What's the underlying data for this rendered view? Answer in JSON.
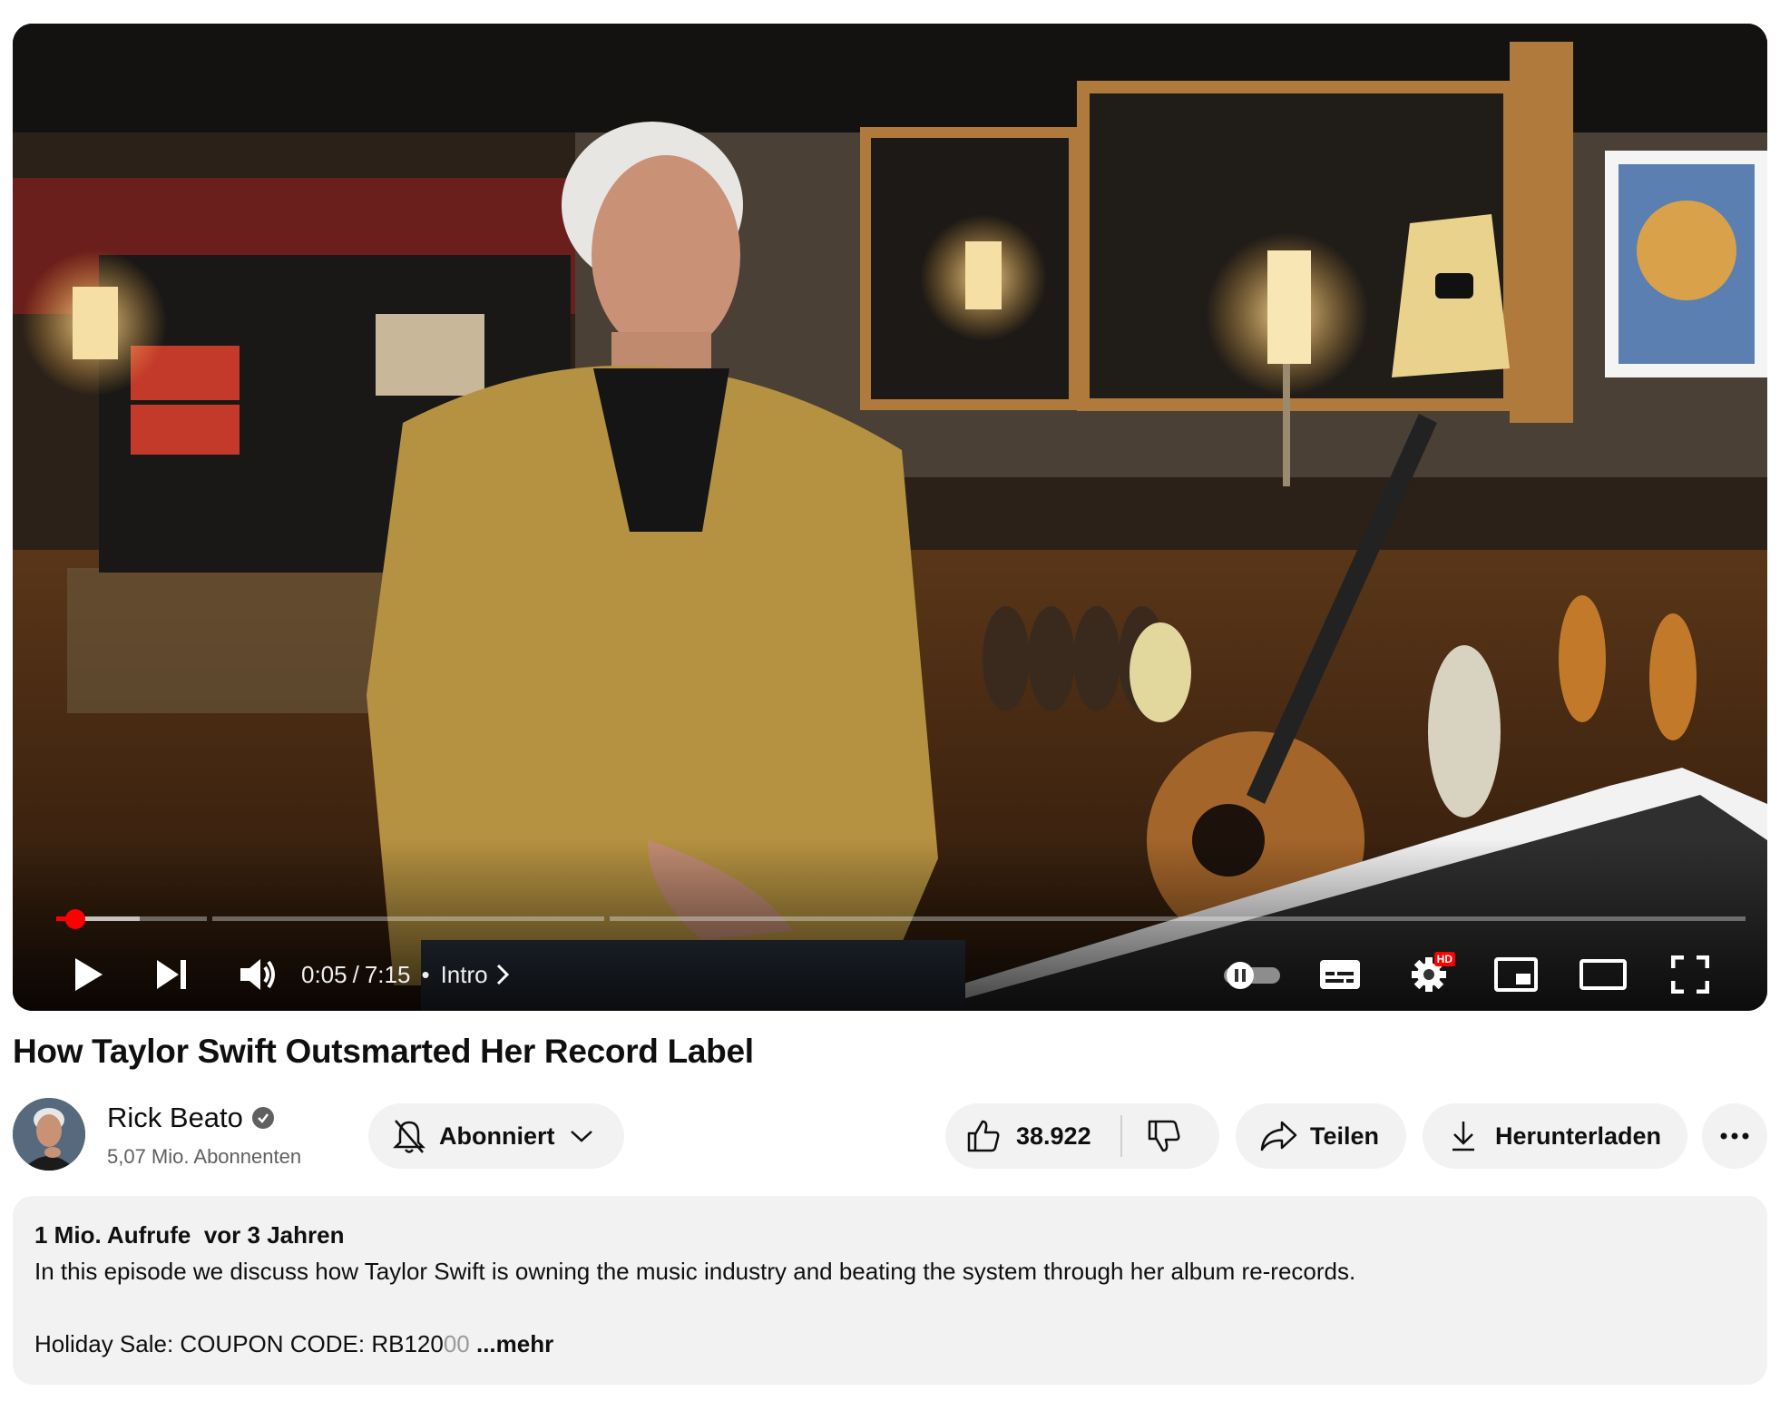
{
  "player": {
    "current_time": "0:05",
    "separator": "/",
    "duration": "7:15",
    "dot": "•",
    "chapter": "Intro",
    "progress_fraction": 0.0115,
    "quality_badge": "HD"
  },
  "video": {
    "title": "How Taylor Swift Outsmarted Her Record Label"
  },
  "channel": {
    "name": "Rick Beato",
    "subscribers": "5,07 Mio. Abonnenten",
    "subscribe_label": "Abonniert"
  },
  "actions": {
    "likes": "38.922",
    "share_label": "Teilen",
    "download_label": "Herunterladen"
  },
  "description": {
    "views": "1 Mio. Aufrufe",
    "age": "vor 3 Jahren",
    "line1": "In this episode we discuss how Taylor Swift is owning the music industry and beating the system through her album re-records.",
    "line2_visible": "Holiday Sale: COUPON CODE: RB120",
    "line2_faded": "00",
    "more_label": "...mehr"
  }
}
